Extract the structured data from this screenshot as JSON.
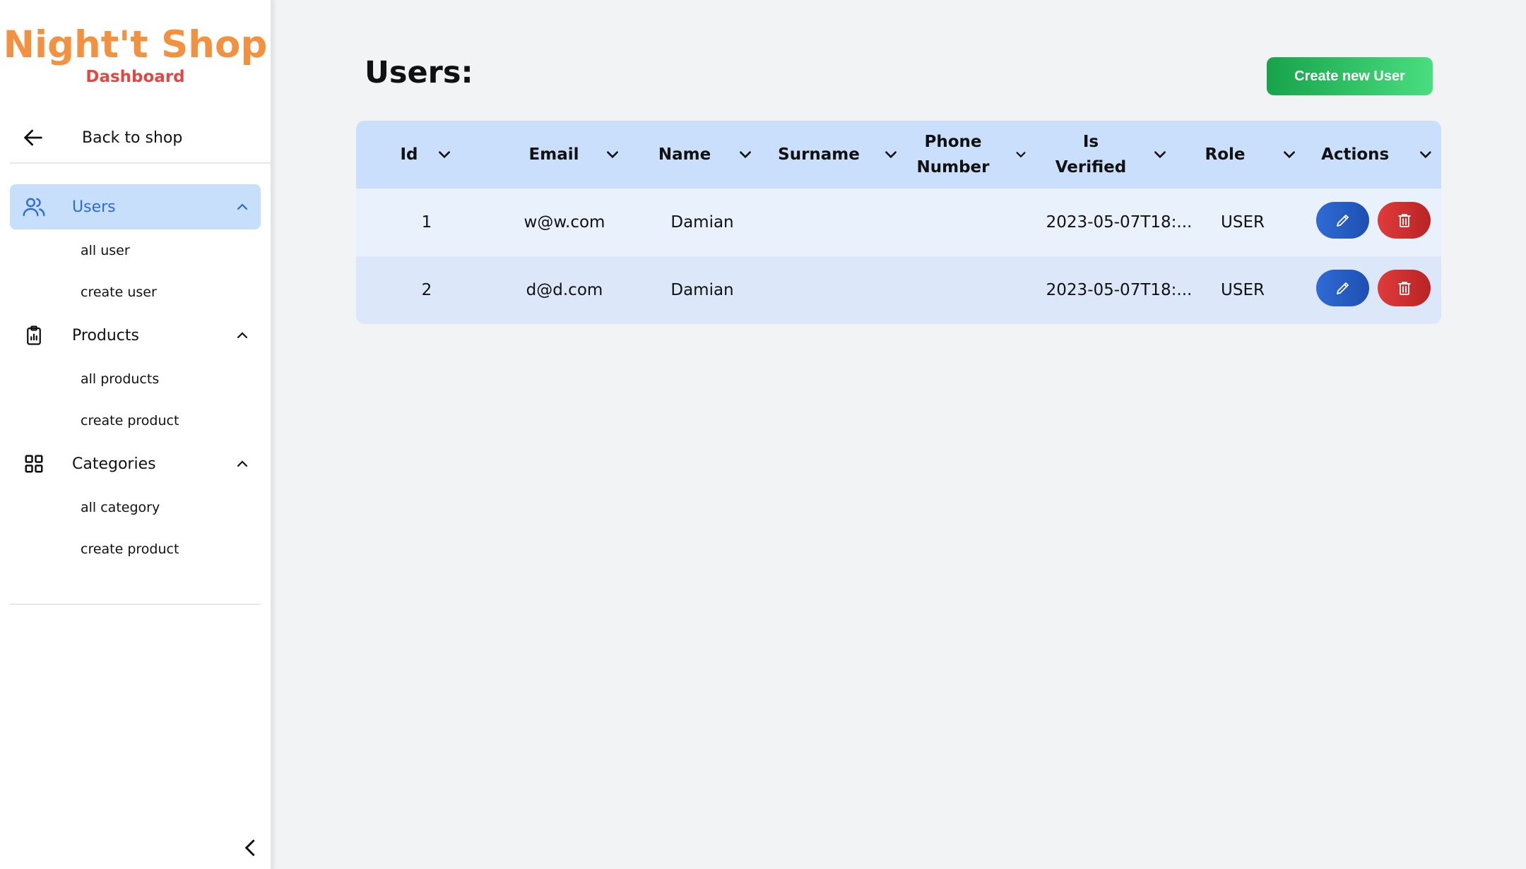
{
  "brand": {
    "title": "Night't Shop",
    "subtitle": "Dashboard"
  },
  "sidebar": {
    "back_label": "Back to shop",
    "sections": [
      {
        "label": "Users",
        "icon": "users-icon",
        "items": [
          "all user",
          "create user"
        ]
      },
      {
        "label": "Products",
        "icon": "clipboard-icon",
        "items": [
          "all products",
          "create product"
        ]
      },
      {
        "label": "Categories",
        "icon": "grid-icon",
        "items": [
          "all category",
          "create product"
        ]
      }
    ]
  },
  "main": {
    "title": "Users:",
    "create_button": "Create new User",
    "columns": [
      "Id",
      "Email",
      "Name",
      "Surname",
      "Phone Number",
      "Is Verified",
      "Role",
      "Actions"
    ],
    "rows": [
      {
        "id": "1",
        "email": "w@w.com",
        "name": "Damian",
        "surname": "",
        "phone": "",
        "verified": "2023-05-07T18:...",
        "role": "USER"
      },
      {
        "id": "2",
        "email": "d@d.com",
        "name": "Damian",
        "surname": "",
        "phone": "",
        "verified": "2023-05-07T18:...",
        "role": "USER"
      }
    ]
  },
  "colors": {
    "accent_orange": "#f2913f",
    "accent_red": "#e04845",
    "active_blue": "#2d6bd8",
    "green": "#17a34a"
  }
}
